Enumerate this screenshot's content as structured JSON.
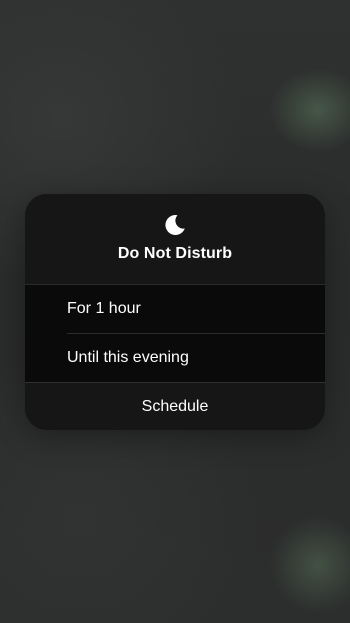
{
  "dnd_menu": {
    "icon": "moon-icon",
    "title": "Do Not Disturb",
    "options": [
      {
        "label": "For 1 hour"
      },
      {
        "label": "Until this evening"
      }
    ],
    "schedule_label": "Schedule"
  },
  "colors": {
    "card_background": "#141414",
    "text": "#ffffff",
    "backdrop": "#2b2c2c"
  }
}
